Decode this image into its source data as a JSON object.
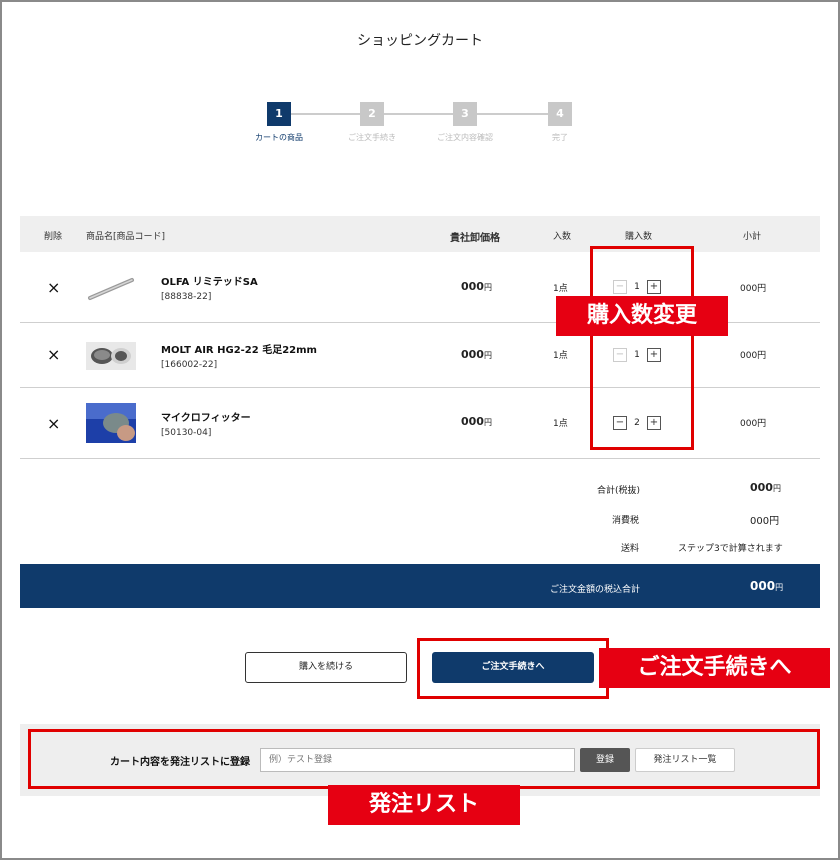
{
  "page": {
    "title": "ショッピングカート"
  },
  "steps": [
    {
      "num": "1",
      "label": "カートの商品",
      "active": true
    },
    {
      "num": "2",
      "label": "ご注文手続き",
      "active": false
    },
    {
      "num": "3",
      "label": "ご注文内容確認",
      "active": false
    },
    {
      "num": "4",
      "label": "完了",
      "active": false
    }
  ],
  "table": {
    "headers": {
      "delete": "削除",
      "name": "商品名[商品コード]",
      "price": "貴社卸価格",
      "unit": "入数",
      "qty": "購入数",
      "subtotal": "小計"
    },
    "rows": [
      {
        "delete_icon": "×",
        "name": "OLFA リミテッドSA",
        "code": "[88838-22]",
        "price": "000",
        "price_unit": "円",
        "unit": "1点",
        "qty_minus": "−",
        "qty": "1",
        "qty_plus": "+",
        "subtotal": "000円"
      },
      {
        "delete_icon": "×",
        "name": "MOLT AIR HG2-22 毛足22mm",
        "code": "[166002-22]",
        "price": "000",
        "price_unit": "円",
        "unit": "1点",
        "qty_minus": "−",
        "qty": "1",
        "qty_plus": "+",
        "subtotal": "000円"
      },
      {
        "delete_icon": "×",
        "name": "マイクロフィッター",
        "code": "[50130-04]",
        "price": "000",
        "price_unit": "円",
        "unit": "1点",
        "qty_minus": "−",
        "qty": "2",
        "qty_plus": "+",
        "subtotal": "000円"
      }
    ]
  },
  "totals": {
    "subtotal_label": "合計(税抜)",
    "subtotal_value": "000",
    "subtotal_unit": "円",
    "tax_label": "消費税",
    "tax_value": "000円",
    "shipping_label": "送料",
    "shipping_value": "ステップ3で計算されます",
    "grand_label": "ご注文金額の税込合計",
    "grand_value": "000",
    "grand_unit": "円"
  },
  "actions": {
    "continue_label": "購入を続ける",
    "checkout_label": "ご注文手続きへ"
  },
  "order_list": {
    "label": "カート内容を発注リストに登録",
    "placeholder": "例）テスト登録",
    "register_label": "登録",
    "view_label": "発注リスト一覧"
  },
  "annotations": {
    "qty_change": "購入数変更",
    "checkout": "ご注文手続きへ",
    "order_list": "発注リスト"
  },
  "colors": {
    "brand": "#0f3a6b",
    "annotation": "#e60012"
  }
}
